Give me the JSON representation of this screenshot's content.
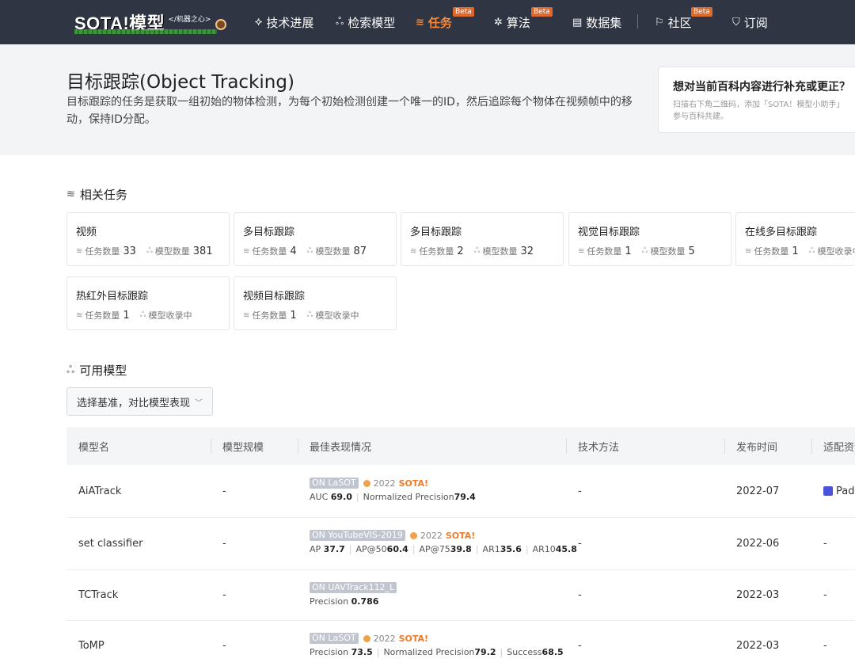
{
  "nav": {
    "logo_text": "SOTA!模型",
    "logo_tag": "</机器之心>",
    "items": [
      {
        "label": "技术进展",
        "icon": "tree-icon"
      },
      {
        "label": "检索模型",
        "icon": "nodes-icon"
      },
      {
        "label": "任务",
        "icon": "layers-icon",
        "badge": "Beta",
        "active": true
      },
      {
        "label": "算法",
        "icon": "atom-icon",
        "badge": "Beta"
      },
      {
        "label": "数据集",
        "icon": "database-icon"
      },
      {
        "label": "社区",
        "icon": "flag-icon",
        "badge": "Beta"
      },
      {
        "label": "订阅",
        "icon": "bookmark-icon"
      }
    ]
  },
  "hero": {
    "title": "目标跟踪(Object Tracking)",
    "description": "目标跟踪的任务是获取一组初始的物体检测，为每个初始检测创建一个唯一的ID，然后追踪每个物体在视频帧中的移动，保持ID分配。",
    "contrib_title": "想对当前百科内容进行补充或更正？",
    "contrib_desc_1": "扫描右下角二维码，添加「SOTA！模型小助手」",
    "contrib_desc_2": "参与百科共建。"
  },
  "related": {
    "title": "相关任务",
    "task_label": "任务数量",
    "model_label": "模型数量",
    "cards": [
      {
        "name": "视频",
        "tasks": "33",
        "models": "381"
      },
      {
        "name": "多目标跟踪",
        "tasks": "4",
        "models": "87"
      },
      {
        "name": "多目标跟踪",
        "tasks": "2",
        "models": "32"
      },
      {
        "name": "视觉目标跟踪",
        "tasks": "1",
        "models": "5"
      },
      {
        "name": "在线多目标跟踪",
        "tasks": "1",
        "models_text": "模型收录中"
      },
      {
        "name": "热红外目标跟踪",
        "tasks": "1",
        "models_text": "模型收录中"
      },
      {
        "name": "视频目标跟踪",
        "tasks": "1",
        "models_text": "模型收录中"
      }
    ]
  },
  "models": {
    "title": "可用模型",
    "select_label": "选择基准，对比模型表现",
    "columns": [
      "模型名",
      "模型规模",
      "最佳表现情况",
      "技术方法",
      "发布时间",
      "适配资源"
    ],
    "rows": [
      {
        "name": "AiATrack",
        "scale": "-",
        "dataset": "ON LaSOT",
        "year": "2022",
        "sota": "SOTA!",
        "metrics": [
          {
            "k": "AUC ",
            "v": "69.0"
          },
          {
            "k": "Normalized Precision",
            "v": "79.4"
          }
        ],
        "method": "-",
        "date": "2022-07",
        "resource": "Paddle"
      },
      {
        "name": "set classifier",
        "scale": "-",
        "dataset": "ON YouTubeVIS-2019",
        "year": "2022",
        "sota": "SOTA!",
        "metrics": [
          {
            "k": "AP ",
            "v": "37.7"
          },
          {
            "k": "AP@50",
            "v": "60.4"
          },
          {
            "k": "AP@75",
            "v": "39.8"
          },
          {
            "k": "AR1",
            "v": "35.6"
          },
          {
            "k": "AR10",
            "v": "45.8"
          }
        ],
        "method": "-",
        "date": "2022-06",
        "resource": "-"
      },
      {
        "name": "TCTrack",
        "scale": "-",
        "dataset": "ON UAVTrack112_L",
        "year": "",
        "sota": "",
        "metrics": [
          {
            "k": "Precision ",
            "v": "0.786"
          }
        ],
        "method": "-",
        "date": "2022-03",
        "resource": "-"
      },
      {
        "name": "ToMP",
        "scale": "-",
        "dataset": "ON LaSOT",
        "year": "2022",
        "sota": "SOTA!",
        "metrics": [
          {
            "k": "Precision ",
            "v": "73.5"
          },
          {
            "k": "Normalized Precision",
            "v": "79.2"
          },
          {
            "k": "Success",
            "v": "68.5"
          }
        ],
        "method": "-",
        "date": "2022-03",
        "resource": "-"
      }
    ]
  }
}
